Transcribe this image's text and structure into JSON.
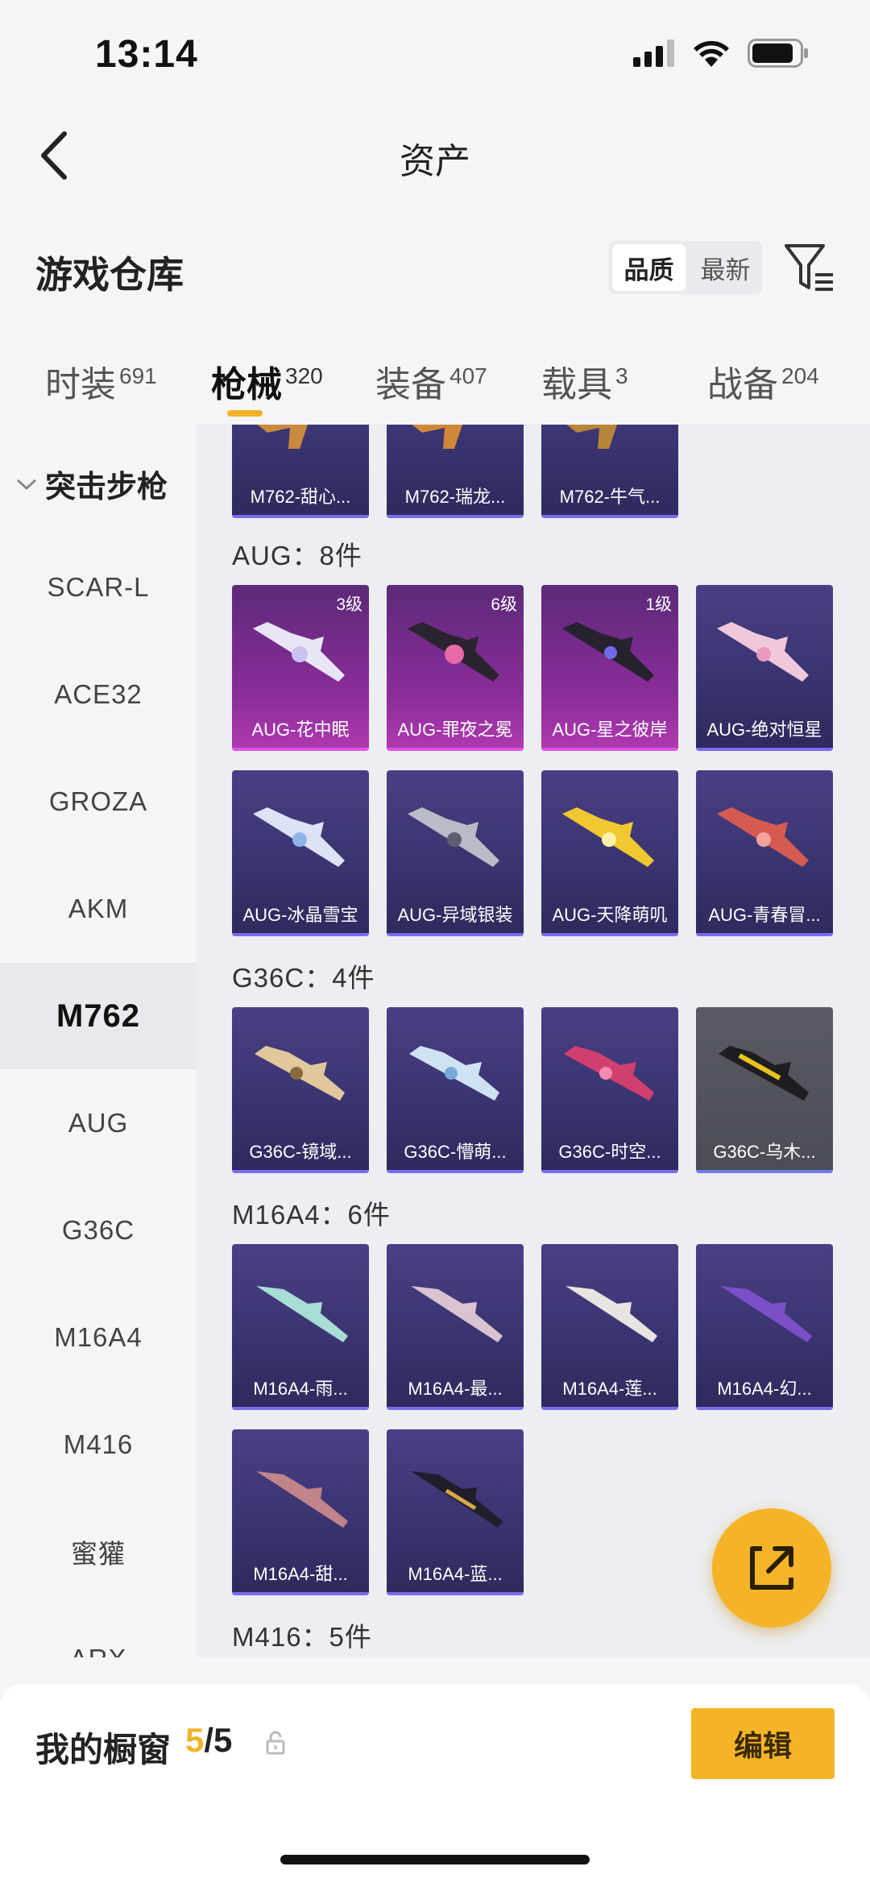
{
  "status_bar": {
    "time": "13:14"
  },
  "nav": {
    "title": "资产"
  },
  "warehouse": {
    "title": "游戏仓库",
    "sort_options": [
      "品质",
      "最新"
    ],
    "active_sort": "品质"
  },
  "tabs": [
    {
      "label": "时装",
      "count": "691"
    },
    {
      "label": "枪械",
      "count": "320"
    },
    {
      "label": "装备",
      "count": "407"
    },
    {
      "label": "载具",
      "count": "3"
    },
    {
      "label": "战备",
      "count": "204"
    }
  ],
  "active_tab": "枪械",
  "sidebar": {
    "category": "突击步枪",
    "items": [
      "SCAR-L",
      "ACE32",
      "GROZA",
      "AKM",
      "M762",
      "AUG",
      "G36C",
      "M16A4",
      "M416",
      "蜜獾",
      "ARX"
    ],
    "active": "M762"
  },
  "sections": {
    "m762_partial": [
      "M762-甜心...",
      "M762-瑞龙...",
      "M762-牛气..."
    ],
    "aug": {
      "header": "AUG：8件",
      "items": [
        {
          "name": "AUG-花中眠",
          "level": "3级"
        },
        {
          "name": "AUG-罪夜之冕",
          "level": "6级"
        },
        {
          "name": "AUG-星之彼岸",
          "level": "1级"
        },
        {
          "name": "AUG-绝对恒星",
          "level": ""
        },
        {
          "name": "AUG-冰晶雪宝",
          "level": ""
        },
        {
          "name": "AUG-异域银装",
          "level": ""
        },
        {
          "name": "AUG-天降萌叽",
          "level": ""
        },
        {
          "name": "AUG-青春冒...",
          "level": ""
        }
      ]
    },
    "g36c": {
      "header": "G36C：4件",
      "items": [
        "G36C-镜域...",
        "G36C-懵萌...",
        "G36C-时空...",
        "G36C-乌木..."
      ]
    },
    "m16a4": {
      "header": "M16A4：6件",
      "items": [
        "M16A4-雨...",
        "M16A4-最...",
        "M16A4-莲...",
        "M16A4-幻...",
        "M16A4-甜...",
        "M16A4-蓝..."
      ]
    },
    "m416": {
      "header": "M416：5件"
    }
  },
  "bottom_bar": {
    "title": "我的橱窗",
    "count_current": "5",
    "count_sep_total": "/5",
    "edit_label": "编辑"
  },
  "colors": {
    "accent": "#f5b428",
    "card_purple": "#3a3470",
    "card_pink": "#8a2c9a"
  }
}
